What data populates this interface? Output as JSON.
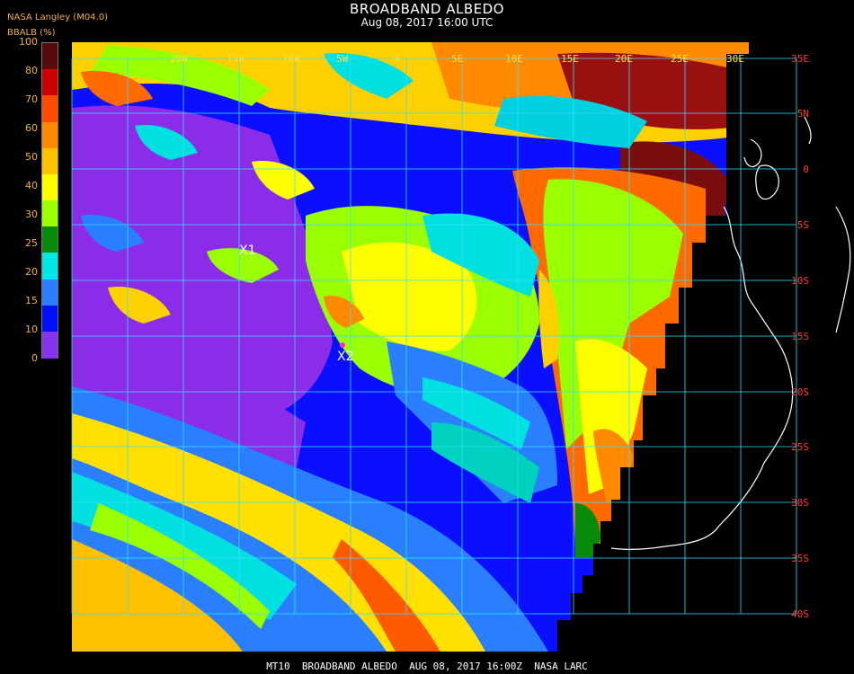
{
  "header": {
    "title": "BROADBAND ALBEDO",
    "subtitle": "Aug 08, 2017 16:00 UTC",
    "credit": "NASA Langley (M04.0)",
    "units": "BBALB (%)"
  },
  "colorbar": {
    "labels": [
      "100",
      "80",
      "70",
      "60",
      "50",
      "40",
      "30",
      "25",
      "20",
      "15",
      "10",
      "0"
    ],
    "colors": [
      "#5a0a0a",
      "#cc0000",
      "#ff4a00",
      "#ff8a00",
      "#ffc000",
      "#ffff00",
      "#9aff00",
      "#0a8a0a",
      "#00e5e5",
      "#2a7fff",
      "#0010ff",
      "#8833ee"
    ]
  },
  "map": {
    "lat_labels": [
      "35E",
      "5N",
      "0",
      "5S",
      "10S",
      "15S",
      "20S",
      "25S",
      "30S",
      "35S",
      "40S"
    ],
    "lon_labels": [
      "20W",
      "15W",
      "10W",
      "5W",
      "0",
      "5E",
      "10E",
      "15E",
      "20E",
      "25E",
      "30E"
    ],
    "markers": [
      "X1",
      "X2"
    ],
    "grid_color": "#33e0ff",
    "lat_label_color": "#ff3a3a",
    "lon_label_color": "#ffe040",
    "coast_color": "#ffffff"
  },
  "footer": "MT10  BROADBAND ALBEDO  AUG 08, 2017 16:00Z  NASA LARC"
}
